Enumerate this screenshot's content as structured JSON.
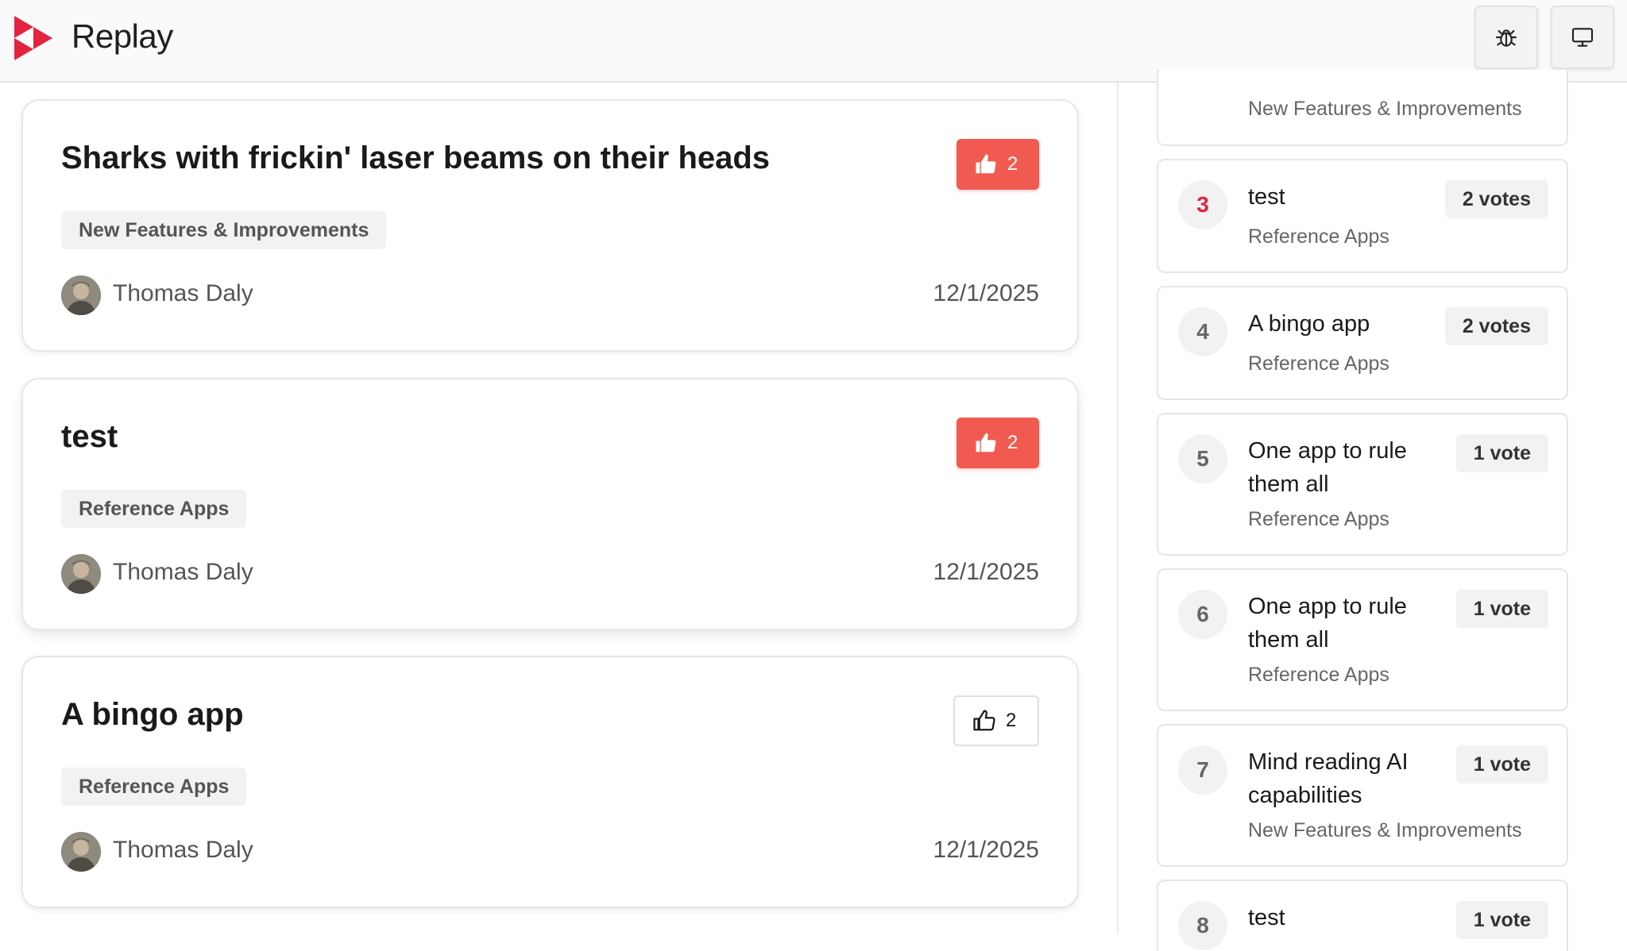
{
  "app": {
    "name": "Replay",
    "brand_color": "#e3233f"
  },
  "toolbar": {
    "bug_icon": "bug-icon",
    "screen_icon": "monitor-icon"
  },
  "posts": [
    {
      "title": "Sharks with frickin' laser beams on their heads",
      "votes": "2",
      "voted": true,
      "category": "New Features & Improvements",
      "author": "Thomas Daly",
      "date": "12/1/2025"
    },
    {
      "title": "test",
      "votes": "2",
      "voted": true,
      "category": "Reference Apps",
      "author": "Thomas Daly",
      "date": "12/1/2025"
    },
    {
      "title": "A bingo app",
      "votes": "2",
      "voted": false,
      "category": "Reference Apps",
      "author": "Thomas Daly",
      "date": "12/1/2025"
    }
  ],
  "leaderboard": {
    "partial_top": {
      "category": "New Features & Improvements"
    },
    "items": [
      {
        "rank": "3",
        "title": "test",
        "category": "Reference Apps",
        "votes": "2 votes"
      },
      {
        "rank": "4",
        "title": "A bingo app",
        "category": "Reference Apps",
        "votes": "2 votes"
      },
      {
        "rank": "5",
        "title": "One app to rule them all",
        "category": "Reference Apps",
        "votes": "1 vote"
      },
      {
        "rank": "6",
        "title": "One app to rule them all",
        "category": "Reference Apps",
        "votes": "1 vote"
      },
      {
        "rank": "7",
        "title": "Mind reading AI capabilities",
        "category": "New Features & Improvements",
        "votes": "1 vote"
      },
      {
        "rank": "8",
        "title": "test",
        "category": "",
        "votes": "1 vote"
      }
    ]
  },
  "colors": {
    "vote_active": "#f05a50",
    "tag_bg": "#f2f2f2",
    "rank_hot": "#e3233f"
  }
}
